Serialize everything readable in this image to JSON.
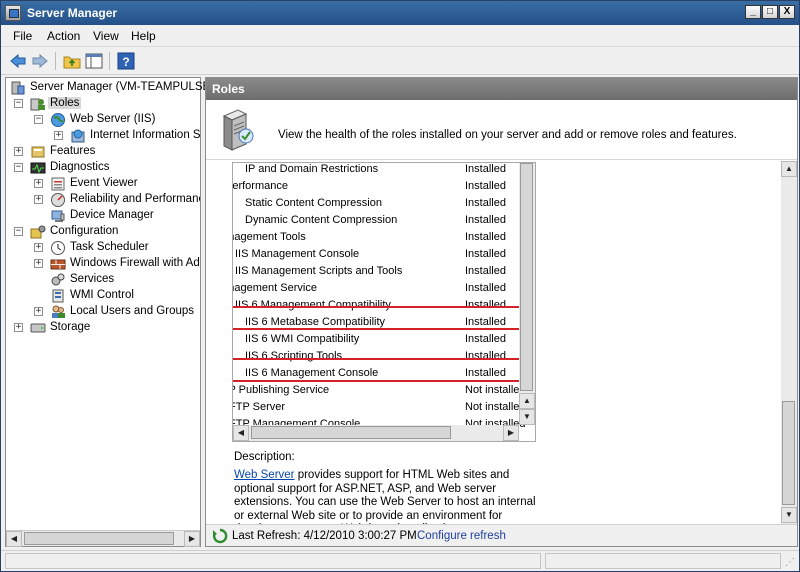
{
  "window": {
    "title": "Server Manager",
    "controls": {
      "minimize": "_",
      "maximize": "□",
      "close": "X"
    }
  },
  "menu": {
    "items": [
      "File",
      "Action",
      "View",
      "Help"
    ]
  },
  "toolbar": {
    "buttons": [
      "back-arrow-icon",
      "forward-arrow-icon",
      "up-folder-icon",
      "show-hide-tree-icon",
      "help-icon"
    ]
  },
  "tree": {
    "items": [
      {
        "label": "Server Manager (VM-TEAMPULSE)",
        "icon": "server-manager-icon",
        "expander": ""
      },
      {
        "label": "Roles",
        "icon": "roles-icon",
        "expander": "−"
      },
      {
        "label": "Web Server (IIS)",
        "icon": "globe-icon",
        "expander": "−"
      },
      {
        "label": "Internet Information Services",
        "icon": "iis-manager-icon",
        "expander": "+"
      },
      {
        "label": "Features",
        "icon": "features-icon",
        "expander": "+"
      },
      {
        "label": "Diagnostics",
        "icon": "diagnostics-icon",
        "expander": "−"
      },
      {
        "label": "Event Viewer",
        "icon": "event-viewer-icon",
        "expander": "+"
      },
      {
        "label": "Reliability and Performance",
        "icon": "performance-icon",
        "expander": "+"
      },
      {
        "label": "Device Manager",
        "icon": "device-manager-icon",
        "expander": ""
      },
      {
        "label": "Configuration",
        "icon": "configuration-icon",
        "expander": "−"
      },
      {
        "label": "Task Scheduler",
        "icon": "clock-icon",
        "expander": "+"
      },
      {
        "label": "Windows Firewall with Advanced Security",
        "icon": "firewall-icon",
        "expander": "+"
      },
      {
        "label": "Services",
        "icon": "services-icon",
        "expander": ""
      },
      {
        "label": "WMI Control",
        "icon": "wmi-icon",
        "expander": ""
      },
      {
        "label": "Local Users and Groups",
        "icon": "users-icon",
        "expander": "+"
      },
      {
        "label": "Storage",
        "icon": "storage-icon",
        "expander": "+"
      }
    ]
  },
  "roles": {
    "header": "Roles",
    "summary": "View the health of the roles installed on your server and add or remove roles and features."
  },
  "services_list": {
    "rows": [
      {
        "name": "IP and Domain Restrictions",
        "status": "Installed"
      },
      {
        "name": "Performance",
        "status": "Installed"
      },
      {
        "name": "Static Content Compression",
        "status": "Installed"
      },
      {
        "name": "Dynamic Content Compression",
        "status": "Installed"
      },
      {
        "name": "Management Tools",
        "status": "Installed"
      },
      {
        "name": "IIS Management Console",
        "status": "Installed"
      },
      {
        "name": "IIS Management Scripts and Tools",
        "status": "Installed"
      },
      {
        "name": "Management Service",
        "status": "Installed"
      },
      {
        "name": "IIS 6 Management Compatibility",
        "status": "Installed"
      },
      {
        "name": "IIS 6 Metabase Compatibility",
        "status": "Installed"
      },
      {
        "name": "IIS 6 WMI Compatibility",
        "status": "Installed"
      },
      {
        "name": "IIS 6 Scripting Tools",
        "status": "Installed"
      },
      {
        "name": "IIS 6 Management Console",
        "status": "Installed"
      },
      {
        "name": "FTP Publishing Service",
        "status": "Not installed"
      },
      {
        "name": "FTP Server",
        "status": "Not installed"
      },
      {
        "name": "FTP Management Console",
        "status": "Not installed"
      }
    ]
  },
  "description": {
    "label": "Description:",
    "link": "Web Server",
    "text": " provides support for HTML Web sites and optional support for ASP.NET, ASP, and Web server extensions. You can use the Web Server to host an internal or external Web site or to provide an environment for developers to create Web-based applications."
  },
  "status": {
    "last_refresh": "Last Refresh: 4/12/2010 3:00:27 PM",
    "configure_refresh": "Configure refresh"
  }
}
